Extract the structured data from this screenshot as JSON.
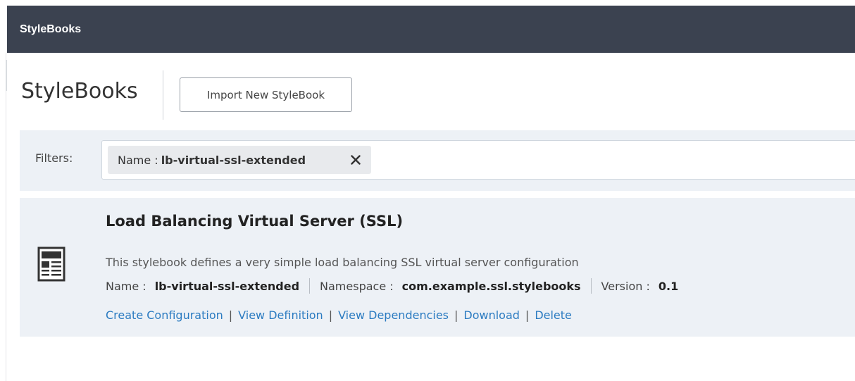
{
  "header": {
    "title": "StyleBooks"
  },
  "page": {
    "title": "StyleBooks",
    "import_button_label": "Import New StyleBook"
  },
  "filters": {
    "label": "Filters:",
    "chips": [
      {
        "key": "Name :",
        "value": "lb-virtual-ssl-extended"
      }
    ]
  },
  "stylebook": {
    "title": "Load Balancing Virtual Server (SSL)",
    "description": "This stylebook defines a very simple load balancing SSL virtual server configuration",
    "name_label": "Name :",
    "name_value": "lb-virtual-ssl-extended",
    "namespace_label": "Namespace :",
    "namespace_value": "com.example.ssl.stylebooks",
    "version_label": "Version :",
    "version_value": "0.1",
    "actions": {
      "create": "Create Configuration",
      "view_definition": "View Definition",
      "view_dependencies": "View Dependencies",
      "download": "Download",
      "delete": "Delete",
      "separator": "|"
    }
  },
  "colors": {
    "header_bg": "#3b4250",
    "panel_bg": "#edf1f6",
    "link": "#2b7bc1"
  },
  "icons": {
    "chip_close": "close-icon",
    "stylebook": "document-layout-icon"
  }
}
